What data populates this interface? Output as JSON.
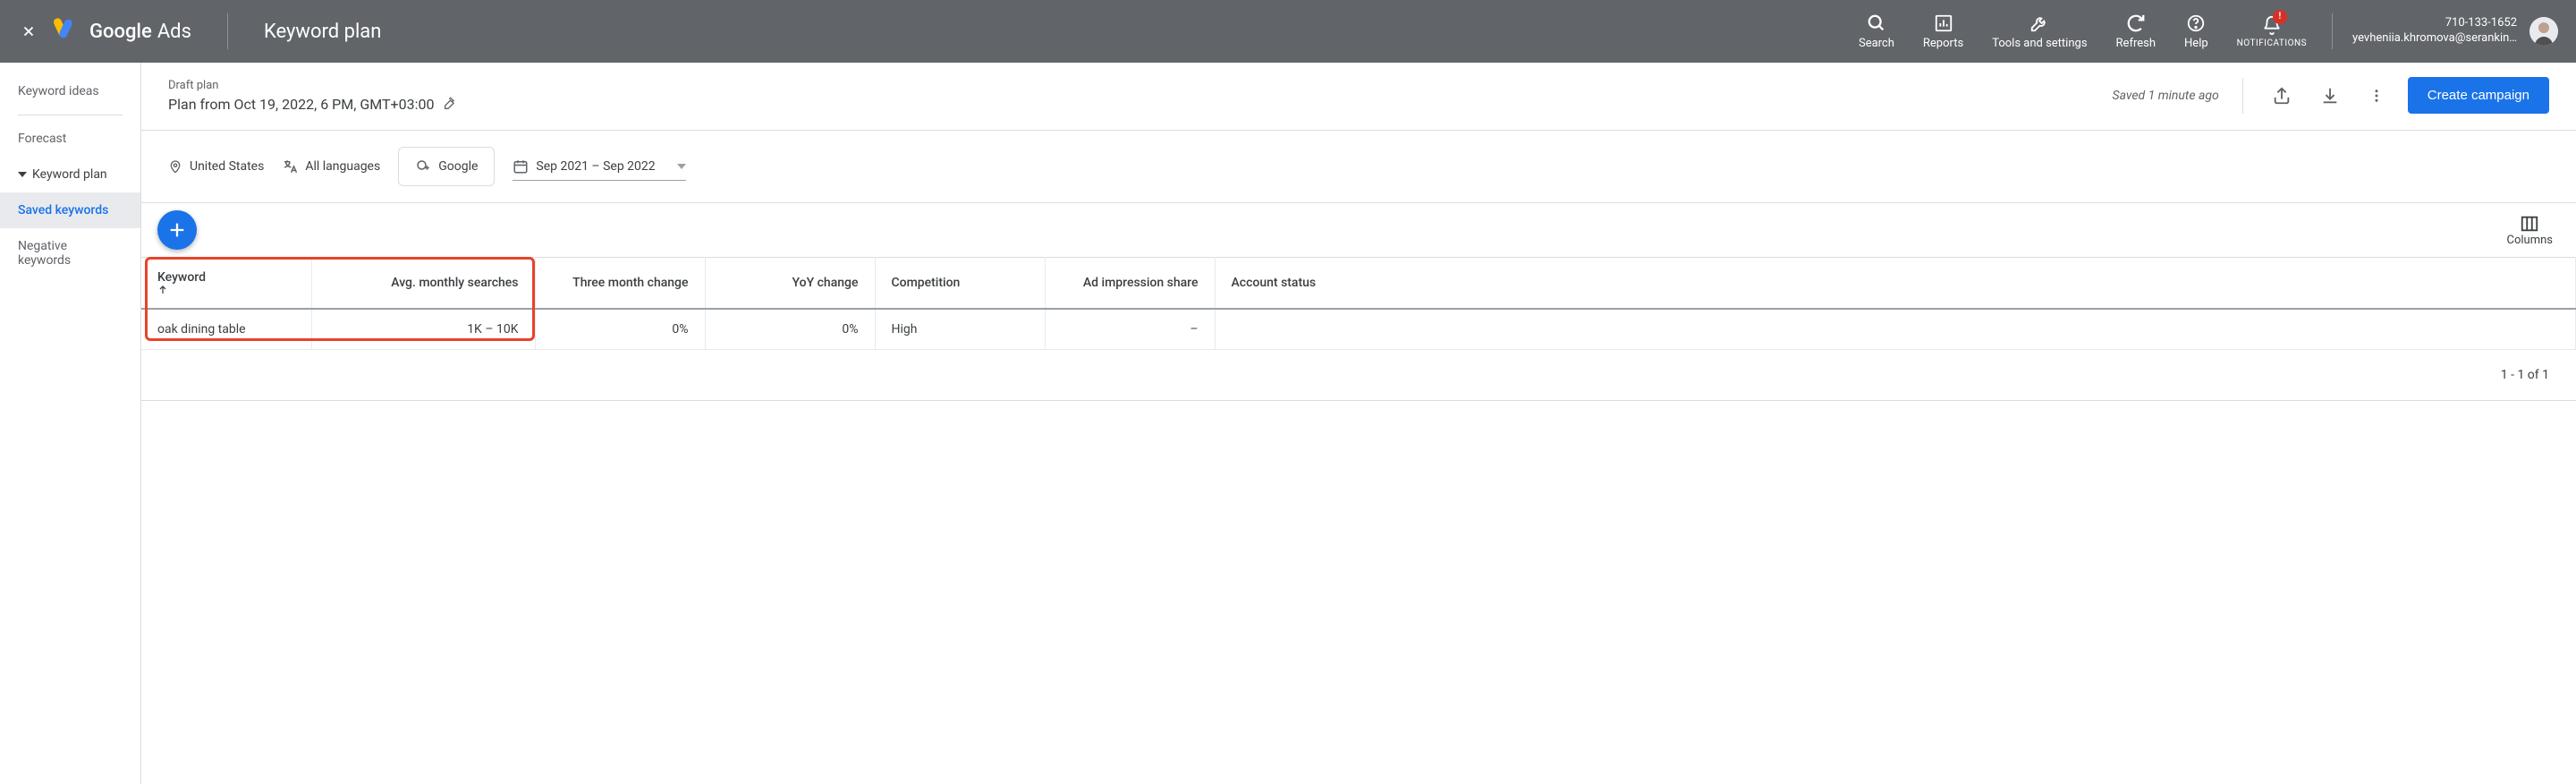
{
  "header": {
    "brand_main": "Google",
    "brand_sub": "Ads",
    "page_title": "Keyword plan",
    "actions": {
      "search": "Search",
      "reports": "Reports",
      "tools": "Tools and settings",
      "refresh": "Refresh",
      "help": "Help",
      "notifications": "NOTIFICATIONS",
      "notif_badge": "!"
    },
    "user": {
      "account_id": "710-133-1652",
      "email": "yevheniia.khromova@serankin…"
    }
  },
  "sidebar": {
    "keyword_ideas": "Keyword ideas",
    "forecast": "Forecast",
    "keyword_plan": "Keyword plan",
    "saved_keywords": "Saved keywords",
    "negative_keywords": "Negative keywords"
  },
  "plan": {
    "draft_label": "Draft plan",
    "name": "Plan from Oct 19, 2022, 6 PM, GMT+03:00",
    "saved_text": "Saved 1 minute ago",
    "create_campaign": "Create campaign"
  },
  "filters": {
    "location": "United States",
    "languages": "All languages",
    "network": "Google",
    "date_range": "Sep 2021 – Sep 2022"
  },
  "columns_btn": "Columns",
  "table": {
    "headers": {
      "keyword": "Keyword",
      "avg_searches": "Avg. monthly searches",
      "three_month": "Three month change",
      "yoy": "YoY change",
      "competition": "Competition",
      "impression": "Ad impression share",
      "account_status": "Account status"
    },
    "rows": [
      {
        "keyword": "oak dining table",
        "avg_searches": "1K – 10K",
        "three_month": "0%",
        "yoy": "0%",
        "competition": "High",
        "impression": "–",
        "account_status": ""
      }
    ],
    "pager": "1 - 1 of 1"
  }
}
